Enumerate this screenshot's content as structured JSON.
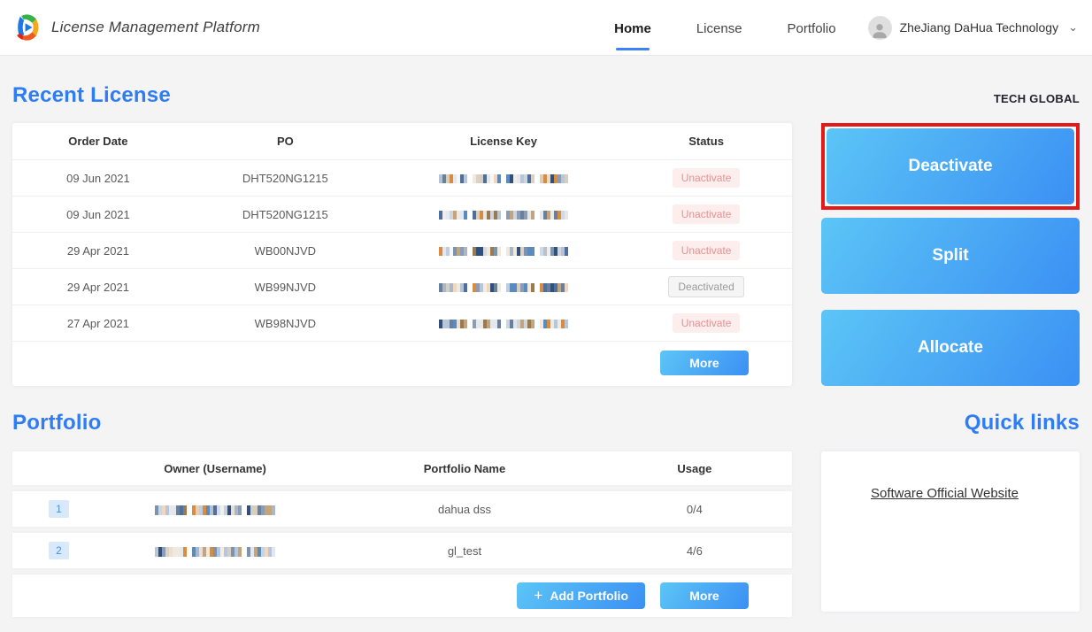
{
  "header": {
    "title": "License Management Platform",
    "nav": [
      {
        "label": "Home",
        "active": true
      },
      {
        "label": "License",
        "active": false
      },
      {
        "label": "Portfolio",
        "active": false
      }
    ],
    "user": {
      "name": "ZheJiang DaHua Technology",
      "icons": [
        "avatar-icon",
        "chevron-down-icon"
      ]
    }
  },
  "recent_license": {
    "heading": "Recent License",
    "company_label": "TECH GLOBAL",
    "columns": [
      "Order Date",
      "PO",
      "License Key",
      "Status"
    ],
    "rows": [
      {
        "order_date": "09 Jun 2021",
        "po": "DHT520NG1215",
        "license_key_redacted": true,
        "status": "Unactivate",
        "status_type": "unactivate"
      },
      {
        "order_date": "09 Jun 2021",
        "po": "DHT520NG1215",
        "license_key_redacted": true,
        "status": "Unactivate",
        "status_type": "unactivate"
      },
      {
        "order_date": "29 Apr 2021",
        "po": "WB00NJVD",
        "license_key_redacted": true,
        "status": "Unactivate",
        "status_type": "unactivate"
      },
      {
        "order_date": "29 Apr 2021",
        "po": "WB99NJVD",
        "license_key_redacted": true,
        "status": "Deactivated",
        "status_type": "deactivated"
      },
      {
        "order_date": "27 Apr 2021",
        "po": "WB98NJVD",
        "license_key_redacted": true,
        "status": "Unactivate",
        "status_type": "unactivate"
      }
    ],
    "more_label": "More"
  },
  "actions": [
    {
      "label": "Deactivate",
      "highlighted": true
    },
    {
      "label": "Split",
      "highlighted": false
    },
    {
      "label": "Allocate",
      "highlighted": false
    }
  ],
  "portfolio": {
    "heading": "Portfolio",
    "columns": [
      "Owner (Username)",
      "Portfolio Name",
      "Usage"
    ],
    "rows": [
      {
        "index": "1",
        "owner_redacted": true,
        "name": "dahua dss",
        "usage": "0/4"
      },
      {
        "index": "2",
        "owner_redacted": true,
        "name": "gl_test",
        "usage": "4/6"
      }
    ],
    "add_label": "Add Portfolio",
    "more_label": "More"
  },
  "quick_links": {
    "heading": "Quick links",
    "links": [
      "Software Official Website"
    ]
  },
  "colors": {
    "accent_blue": "#2e7cf6",
    "button_gradient_start": "#5cc5f6",
    "button_gradient_end": "#3b90f3",
    "highlight_red": "#e41a1a",
    "status_unactivate_bg": "#fdeeee",
    "status_unactivate_text": "#e89090",
    "status_deactivated_bg": "#f5f5f5",
    "status_deactivated_text": "#9a9a9a",
    "active_tab_underline": "#3c82f2"
  }
}
